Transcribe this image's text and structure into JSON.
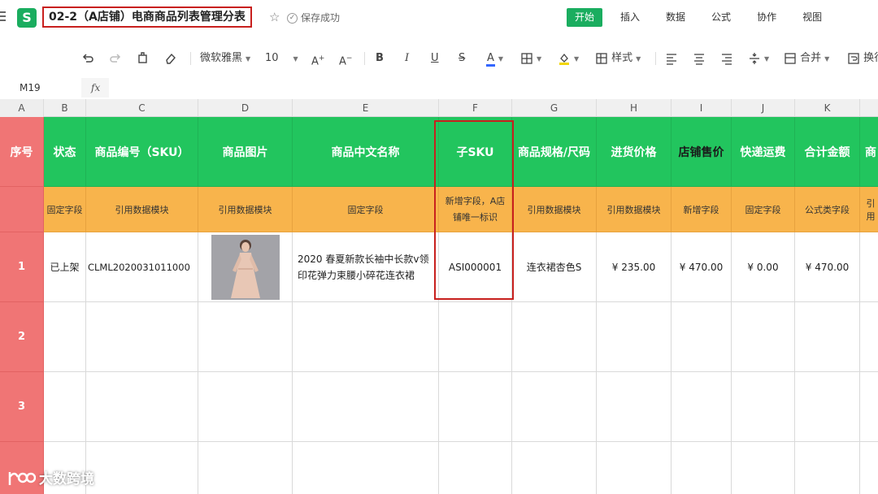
{
  "app": {
    "logo_letter": "S",
    "doc_title": "02-2（A店铺）电商商品列表管理分表",
    "save_status": "保存成功"
  },
  "menu": {
    "tabs": [
      {
        "label": "开始",
        "active": true
      },
      {
        "label": "插入",
        "active": false
      },
      {
        "label": "数据",
        "active": false
      },
      {
        "label": "公式",
        "active": false
      },
      {
        "label": "协作",
        "active": false
      },
      {
        "label": "视图",
        "active": false
      }
    ]
  },
  "toolbar": {
    "font_name": "微软雅黑",
    "font_size": "10",
    "style_label": "样式",
    "merge_label": "合并",
    "wrap_label": "换行"
  },
  "formula_bar": {
    "cell_ref": "M19",
    "fx": "fx",
    "content": ""
  },
  "grid": {
    "row_header_label": "A",
    "column_letters": [
      "B",
      "C",
      "D",
      "E",
      "F",
      "G",
      "H",
      "I",
      "J",
      "K"
    ],
    "headers": [
      "序号",
      "状态",
      "商品编号（SKU）",
      "商品图片",
      "商品中文名称",
      "子SKU",
      "商品规格/尺码",
      "进货价格",
      "店铺售价",
      "快递运费",
      "合计金额",
      "商"
    ],
    "field_types": [
      "固定字段",
      "引用数据模块",
      "引用数据模块",
      "固定字段",
      "新增字段，A店铺唯一标识",
      "引用数据模块",
      "引用数据模块",
      "新增字段",
      "固定字段",
      "公式类字段",
      "引用"
    ],
    "rows": [
      {
        "no": "1",
        "status": "已上架",
        "sku": "CLML2020031011000",
        "image": "商品图片",
        "name": "2020 春夏新款长袖中长款v领印花弹力束腰小碎花连衣裙",
        "sub_sku": "ASI000001",
        "spec": "连衣裙杏色S",
        "cost": "¥ 235.00",
        "price": "¥ 470.00",
        "shipping": "¥ 0.00",
        "total": "¥ 470.00"
      },
      {
        "no": "2"
      },
      {
        "no": "3"
      }
    ]
  },
  "watermark": {
    "text": "大数跨境"
  },
  "colors": {
    "accent": "#1aad5f",
    "header_green": "#22c55e",
    "subheader_orange": "#f8b44c",
    "rownum_red": "#f07575",
    "highlight_red": "#c8201e"
  }
}
